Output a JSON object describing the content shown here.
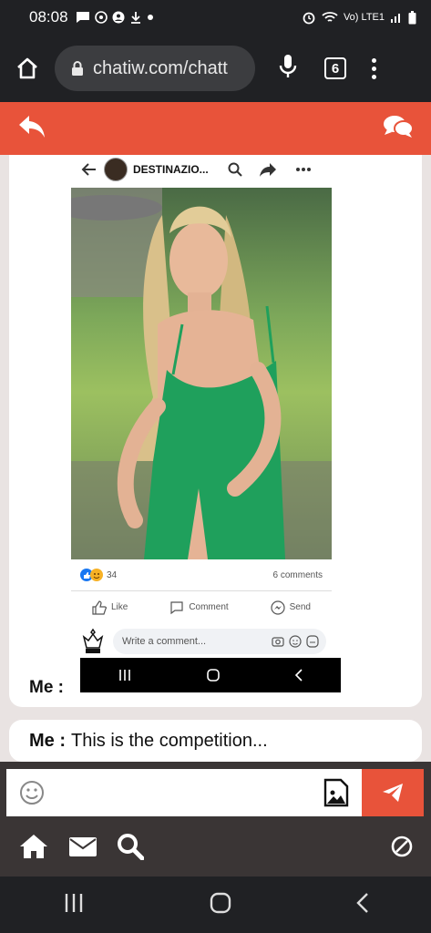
{
  "status_bar": {
    "time": "08:08",
    "network_label": "Vo) LTE1"
  },
  "browser": {
    "url": "chatiw.com/chatt",
    "tab_count": "6"
  },
  "post": {
    "page_name": "DESTINAZIO...",
    "reaction_count": "34",
    "comments_count": "6 comments",
    "like_label": "Like",
    "comment_label": "Comment",
    "send_label": "Send",
    "comment_placeholder": "Write a comment..."
  },
  "messages": [
    {
      "sender": "Me :",
      "text": ""
    },
    {
      "sender": "Me :",
      "text": "This is the competition..."
    }
  ],
  "input": {
    "placeholder": ""
  },
  "colors": {
    "accent": "#e8533a",
    "dark": "#202124",
    "bar": "#3a3535",
    "chat_bg": "#e9e3e2"
  }
}
